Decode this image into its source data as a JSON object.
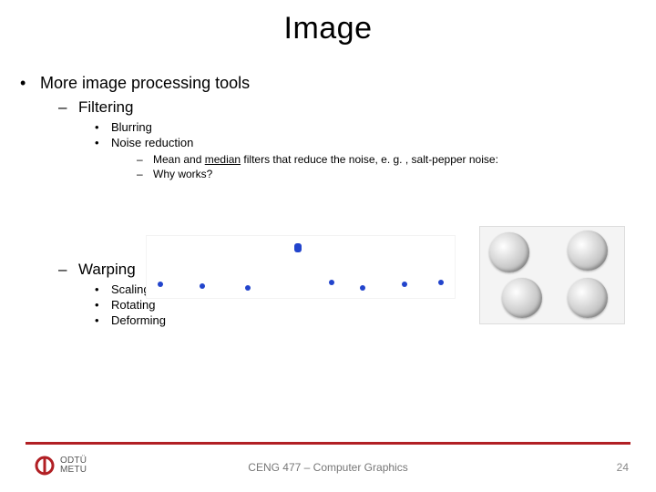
{
  "title": "Image",
  "bullets": {
    "main": "More image processing tools",
    "filtering": {
      "label": "Filtering",
      "items": {
        "blur": "Blurring",
        "noise": "Noise reduction",
        "sub": {
          "a_pre": "Mean and ",
          "a_u": "median",
          "a_post": " filters that reduce the noise, e. g. , salt-pepper noise:",
          "b": "Why works?"
        }
      }
    },
    "warping": {
      "label": "Warping",
      "items": {
        "scale": "Scaling",
        "rotate": "Rotating",
        "deform": "Deforming"
      }
    }
  },
  "footer": {
    "logo_line1": "ODTÜ",
    "logo_line2": "METU",
    "center": "CENG 477 – Computer Graphics",
    "page": "24"
  }
}
